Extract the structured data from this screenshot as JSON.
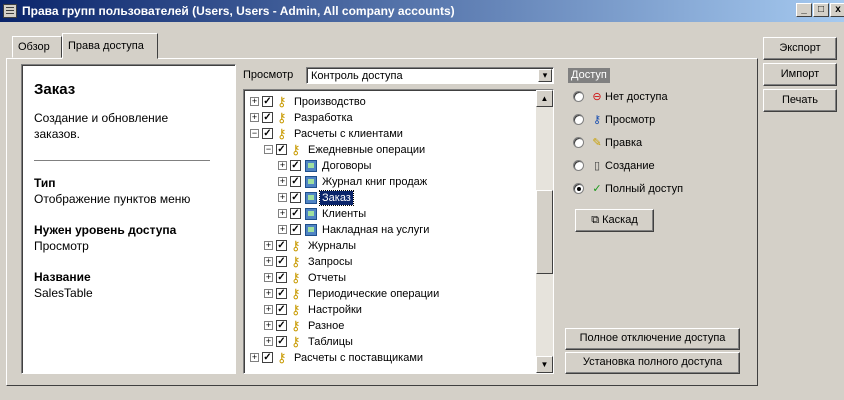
{
  "window": {
    "title": "Права групп пользователей (Users, Users - Admin, All company accounts)",
    "minimize": "_",
    "maximize": "□",
    "close": "x"
  },
  "tabs": [
    {
      "label": "Обзор"
    },
    {
      "label": "Права доступа"
    }
  ],
  "right_buttons": {
    "export": "Экспорт",
    "import": "Импорт",
    "print": "Печать"
  },
  "description": {
    "title": "Заказ",
    "text": "Создание и обновление заказов.",
    "type_heading": "Тип",
    "type_value": "Отображение пунктов меню",
    "level_heading": "Нужен уровень доступа",
    "level_value": "Просмотр",
    "name_heading": "Название",
    "name_value": "SalesTable"
  },
  "view": {
    "label": "Просмотр",
    "value": "Контроль доступа"
  },
  "tree": [
    {
      "label": "Производство",
      "icon": "key-icon",
      "expander": "+",
      "level": 0
    },
    {
      "label": "Разработка",
      "icon": "key-icon",
      "expander": "+",
      "level": 0
    },
    {
      "label": "Расчеты с клиентами",
      "icon": "key-icon",
      "expander": "−",
      "level": 0
    },
    {
      "label": "Ежедневные операции",
      "icon": "key-icon",
      "expander": "−",
      "level": 1
    },
    {
      "label": "Договоры",
      "icon": "menu-item-icon",
      "expander": "+",
      "level": 2
    },
    {
      "label": "Журнал книг продаж",
      "icon": "menu-item-icon",
      "expander": "+",
      "level": 2
    },
    {
      "label": "Заказ",
      "icon": "menu-item-icon",
      "expander": "+",
      "level": 2,
      "selected": true
    },
    {
      "label": "Клиенты",
      "icon": "menu-item-icon",
      "expander": "+",
      "level": 2
    },
    {
      "label": "Накладная на услуги",
      "icon": "menu-item-icon",
      "expander": "+",
      "level": 2
    },
    {
      "label": "Журналы",
      "icon": "key-icon",
      "expander": "+",
      "level": 1
    },
    {
      "label": "Запросы",
      "icon": "key-icon",
      "expander": "+",
      "level": 1
    },
    {
      "label": "Отчеты",
      "icon": "key-icon",
      "expander": "+",
      "level": 1
    },
    {
      "label": "Периодические операции",
      "icon": "key-icon",
      "expander": "+",
      "level": 1
    },
    {
      "label": "Настройки",
      "icon": "key-icon",
      "expander": "+",
      "level": 1
    },
    {
      "label": "Разное",
      "icon": "key-icon",
      "expander": "+",
      "level": 1
    },
    {
      "label": "Таблицы",
      "icon": "key-icon",
      "expander": "+",
      "level": 1
    },
    {
      "label": "Расчеты с поставщиками",
      "icon": "key-icon",
      "expander": "+",
      "level": 0
    }
  ],
  "access": {
    "legend": "Доступ",
    "options": [
      {
        "label": "Нет доступа",
        "icon": "no-entry-icon",
        "color": "#d01010",
        "selected": false
      },
      {
        "label": "Просмотр",
        "icon": "key-icon",
        "color": "#1a4fb0",
        "selected": false
      },
      {
        "label": "Правка",
        "icon": "pencil-icon",
        "color": "#c8a000",
        "selected": false
      },
      {
        "label": "Создание",
        "icon": "new-doc-icon",
        "color": "#404040",
        "selected": false
      },
      {
        "label": "Полный доступ",
        "icon": "checkmark-icon",
        "color": "#1a9a1a",
        "selected": true
      }
    ],
    "cascade_label": "Каскад",
    "disable_all_label": "Полное отключение доступа",
    "full_access_label": "Установка полного доступа"
  },
  "colors": {
    "title_gradient_start": "#0a246a",
    "title_gradient_end": "#a6caf0",
    "face": "#d4d0c8",
    "selection": "#0a246a"
  }
}
